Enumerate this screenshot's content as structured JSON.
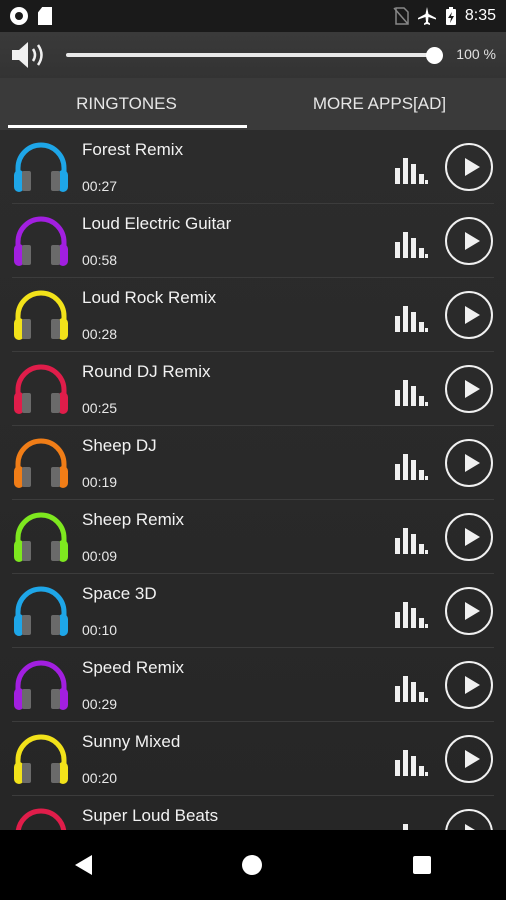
{
  "status_bar": {
    "time": "8:35",
    "left_icons": [
      "record-icon",
      "sd-card-icon"
    ],
    "right_icons": [
      "no-sim-icon",
      "airplane-icon",
      "battery-charging-icon"
    ]
  },
  "volume": {
    "percent_label": "100 %",
    "level_percent": 100,
    "icon": "speaker-icon"
  },
  "tabs": [
    {
      "label": "RINGTONES",
      "active": true
    },
    {
      "label": "MORE APPS[AD]",
      "active": false
    }
  ],
  "ringtones": [
    {
      "title": "Forest Remix",
      "duration": "00:27",
      "color": "#1ea6e8"
    },
    {
      "title": "Loud Electric Guitar",
      "duration": "00:58",
      "color": "#a21fe0"
    },
    {
      "title": "Loud Rock Remix",
      "duration": "00:28",
      "color": "#f2e21a"
    },
    {
      "title": "Round DJ Remix",
      "duration": "00:25",
      "color": "#e01d4a"
    },
    {
      "title": "Sheep DJ",
      "duration": "00:19",
      "color": "#f07d17"
    },
    {
      "title": "Sheep Remix",
      "duration": "00:09",
      "color": "#7ee81f"
    },
    {
      "title": "Space 3D",
      "duration": "00:10",
      "color": "#1ea6e8"
    },
    {
      "title": "Speed Remix",
      "duration": "00:29",
      "color": "#a21fe0"
    },
    {
      "title": "Sunny Mixed",
      "duration": "00:20",
      "color": "#f2e21a"
    },
    {
      "title": "Super Loud Beats",
      "duration": "",
      "color": "#e01d4a"
    }
  ],
  "nav_bar": {
    "icons": [
      "back-icon",
      "home-icon",
      "recents-icon"
    ]
  }
}
